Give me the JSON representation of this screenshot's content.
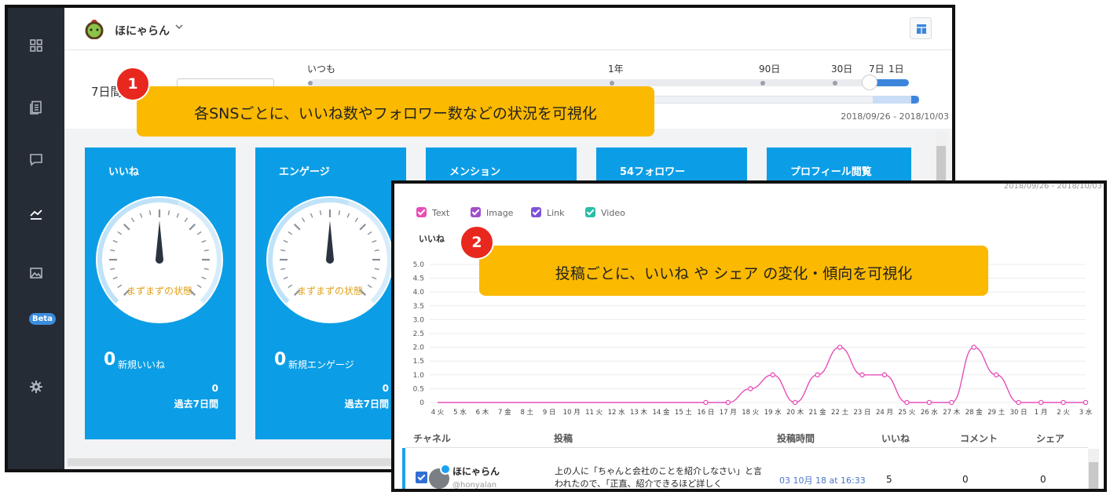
{
  "account": {
    "name": "ほにゃらん",
    "handle": "@honyalan"
  },
  "period": {
    "label": "7日間",
    "timeline_labels": [
      "いつも",
      "1年",
      "90日",
      "30日",
      "7日",
      "1日"
    ],
    "date_range": "2018/09/26 - 2018/10/03"
  },
  "cards": [
    {
      "title": "いいね",
      "status": "まずまずの状態",
      "count": "0",
      "count_label": "新規いいね",
      "prev_value": "0",
      "prev_label": "過去7日間"
    },
    {
      "title": "エンゲージ",
      "status": "まずまずの状態",
      "count": "0",
      "count_label": "新規エンゲージ",
      "prev_value": "0",
      "prev_label": "過去7日間"
    },
    {
      "title": "メンション"
    },
    {
      "title": "54フォロワー"
    },
    {
      "title": "プロフィール閲覧"
    }
  ],
  "callouts": [
    {
      "number": "1",
      "text": "各SNSごとに、いいね数やフォロワー数などの状況を可視化"
    },
    {
      "number": "2",
      "text": "投稿ごとに、いいね や シェア の変化・傾向を可視化"
    }
  ],
  "nav": {
    "beta_label": "Beta"
  },
  "colors": {
    "card_blue": "#0b9ee6",
    "callout_yellow": "#fbb900",
    "badge_red": "#e8281f",
    "sidebar": "#262c36",
    "line_pink": "#e64fb8"
  },
  "icons": [
    "dashboard-icon",
    "posts-icon",
    "messages-icon",
    "analytics-icon",
    "image-icon",
    "settings-icon",
    "chevron-down-icon",
    "layout-icon",
    "twitter-icon"
  ],
  "legend": [
    {
      "label": "Text",
      "color": "#e64fb8"
    },
    {
      "label": "Image",
      "color": "#a14fc8"
    },
    {
      "label": "Link",
      "color": "#7e52d6"
    },
    {
      "label": "Video",
      "color": "#27bfa6"
    }
  ],
  "chart_data": {
    "type": "line",
    "title": "いいね",
    "ylim": [
      0,
      5
    ],
    "y_ticks": [
      "0",
      "0.5",
      "1.0",
      "1.5",
      "2.0",
      "2.5",
      "3.0",
      "3.5",
      "4.0",
      "4.5",
      "5.0"
    ],
    "categories": [
      "4 火",
      "5 水",
      "6 木",
      "7 金",
      "8 土",
      "9 日",
      "10 月",
      "11 火",
      "12 水",
      "13 木",
      "14 金",
      "15 土",
      "16 日",
      "17 月",
      "18 火",
      "19 水",
      "20 木",
      "21 金",
      "22 土",
      "23 日",
      "24 月",
      "25 火",
      "26 水",
      "27 木",
      "28 金",
      "29 土",
      "30 日",
      "1 月",
      "2 火",
      "3 水"
    ],
    "series": [
      {
        "name": "Text",
        "values": [
          0,
          0,
          0,
          0,
          0,
          0,
          0,
          0,
          0,
          0,
          0,
          0,
          0,
          0,
          0.5,
          1,
          0,
          1,
          2,
          1,
          1,
          0,
          0,
          0,
          2,
          1,
          0,
          0,
          0,
          0
        ]
      }
    ],
    "grid": true,
    "legend_position": "top-left"
  },
  "table": {
    "headers": [
      "チャネル",
      "投稿",
      "投稿時間",
      "いいね",
      "コメント",
      "シェア"
    ],
    "rows": [
      {
        "name": "ほにゃらん",
        "handle": "@honyalan",
        "post": "上の人に「ちゃんと会社のことを紹介しなさい」と言われたので、「正直、紹介できるほど詳しく",
        "time": "03 10月 18 at 16:33",
        "likes": "5",
        "comments": "0",
        "shares": "0"
      }
    ]
  }
}
